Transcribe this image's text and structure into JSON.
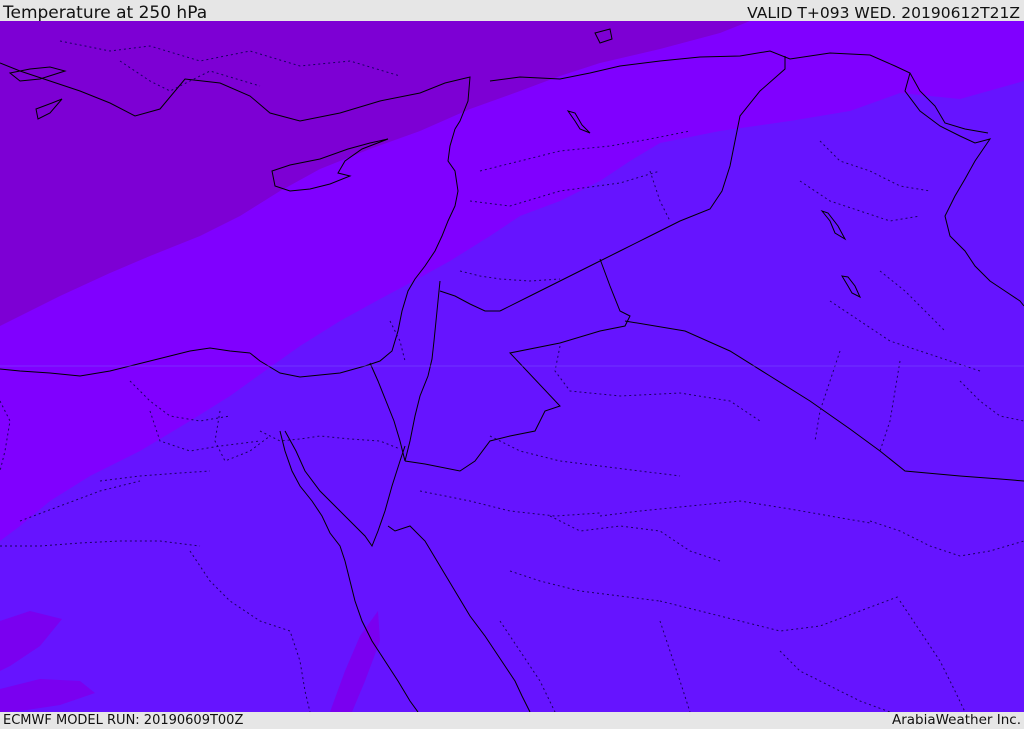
{
  "header": {
    "title": "Temperature at 250 hPa",
    "valid": "VALID T+093 WED. 20190612T21Z"
  },
  "footer": {
    "model_run": "ECMWF MODEL RUN: 20190609T00Z",
    "credit": "ArabiaWeather Inc."
  },
  "map": {
    "shading_colors": {
      "coldest": "#7d00d4",
      "cold": "#8000ff",
      "mild": "#6614ff",
      "low_patch": "#7a00f0"
    },
    "border_color": "#000000"
  }
}
